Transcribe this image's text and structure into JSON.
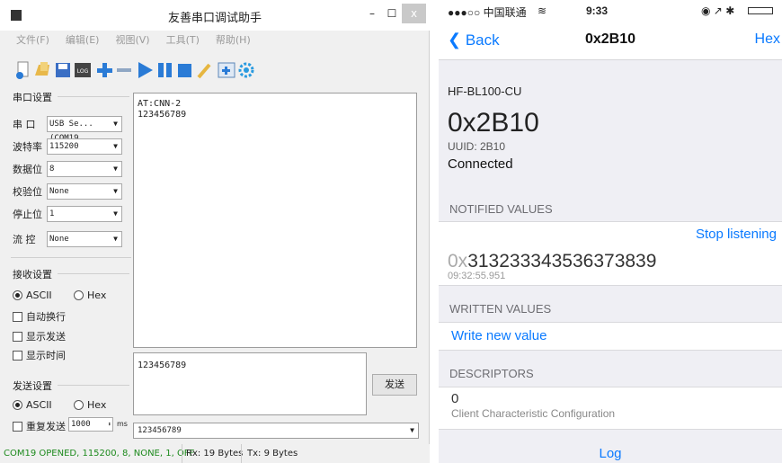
{
  "left": {
    "title": "友善串口调试助手",
    "menu": [
      "文件(F)",
      "编辑(E)",
      "视图(V)",
      "工具(T)",
      "帮助(H)"
    ],
    "serial_group": "串口设置",
    "fields": [
      {
        "label": "串 口",
        "value": "USB Se...(COM19"
      },
      {
        "label": "波特率",
        "value": "115200"
      },
      {
        "label": "数据位",
        "value": "8"
      },
      {
        "label": "校验位",
        "value": "None"
      },
      {
        "label": "停止位",
        "value": "1"
      },
      {
        "label": "流 控",
        "value": "None"
      }
    ],
    "recv_group": "接收设置",
    "recv_ascii": "ASCII",
    "recv_hex": "Hex",
    "recv_checks": [
      "自动换行",
      "显示发送",
      "显示时间"
    ],
    "send_group": "发送设置",
    "send_ascii": "ASCII",
    "send_hex": "Hex",
    "repeat_label": "重复发送",
    "repeat_value": "1000",
    "repeat_unit": "ms",
    "recv_lines": [
      "AT:CNN-2",
      "123456789"
    ],
    "send_text": "123456789",
    "send_button": "发送",
    "history_value": "123456789",
    "status": {
      "open": "COM19 OPENED, 115200, 8, NONE, 1, OFF",
      "rx": "Rx: 19 Bytes",
      "tx": "Tx: 9 Bytes"
    }
  },
  "right": {
    "status_carrier": "●●●○○ 中国联通",
    "status_time": "9:33",
    "back": "Back",
    "nav_title": "0x2B10",
    "hex": "Hex",
    "device": "HF-BL100-CU",
    "big_title": "0x2B10",
    "uuid": "UUID: 2B10",
    "connection": "Connected",
    "notified_header": "NOTIFIED VALUES",
    "stop_listening": "Stop listening",
    "value_prefix": "0x",
    "value": "313233343536373839",
    "timestamp": "09:32:55.951",
    "written_header": "WRITTEN VALUES",
    "write_new": "Write new value",
    "descriptors_header": "DESCRIPTORS",
    "descriptor_value": "0",
    "descriptor_name": "Client Characteristic Configuration",
    "log": "Log"
  }
}
